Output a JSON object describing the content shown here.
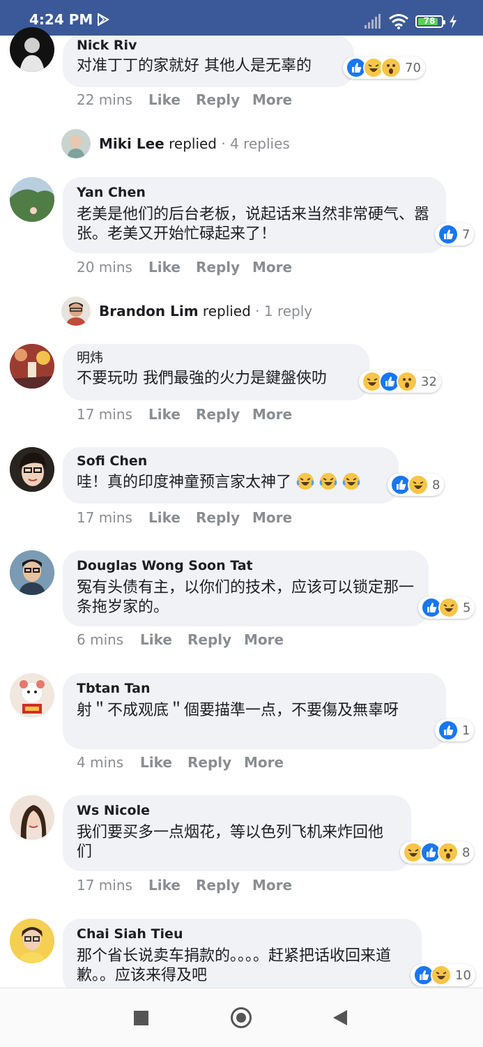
{
  "status_bar": {
    "time": "4:24 PM",
    "battery": "78"
  },
  "comments": [
    {
      "author": "Nick Riv",
      "text": "对准丁丁的家就好 其他人是无辜的",
      "reaction_count": "70",
      "time": "22 mins"
    },
    {
      "author": "Yan Chen",
      "text": "老美是他们的后台老板，说起话来当然非常硬气、嚣张。老美又开始忙碌起来了！",
      "reaction_count": "7",
      "time": "20 mins"
    },
    {
      "author": "明炜",
      "text": "不要玩叻 我們最強的火力是鍵盤俠叻",
      "reaction_count": "32",
      "time": "17 mins"
    },
    {
      "author": "Sofi Chen",
      "text": "哇！真的印度神童预言家太神了",
      "reaction_count": "8",
      "time": "17 mins"
    },
    {
      "author": "Douglas Wong Soon Tat",
      "text": "冤有头债有主，以你们的技术，应该可以锁定那一条拖岁家的。",
      "reaction_count": "5",
      "time": "6 mins"
    },
    {
      "author": "Tbtan Tan",
      "text": "射＂不成观底＂個要描準一点，不要傷及無辜呀",
      "reaction_count": "1",
      "time": "4 mins"
    },
    {
      "author": "Ws Nicole",
      "text": "我们要买多一点烟花，等以色列飞机来炸回他们",
      "reaction_count": "8",
      "time": "17 mins"
    },
    {
      "author": "Chai Siah Tieu",
      "text": "那个省长说卖车捐款的。。。。赶紧把话收回来道歉。。应该来得及吧",
      "reaction_count": "10",
      "time": ""
    }
  ],
  "replies": [
    {
      "name": "Miki Lee",
      "verb": "replied",
      "count": "· 4 replies"
    },
    {
      "name": "Brandon Lim",
      "verb": "replied",
      "count": "· 1 reply"
    }
  ],
  "actions": {
    "like": "Like",
    "reply": "Reply",
    "more": "More"
  }
}
